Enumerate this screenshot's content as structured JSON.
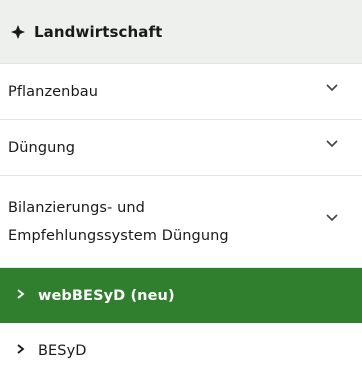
{
  "nav": {
    "header": {
      "label": "Landwirtschaft",
      "icon": "diamond-cross-icon"
    },
    "items": [
      {
        "label": "Pflanzenbau",
        "icon": "chevron-down-icon"
      },
      {
        "label": "Düngung",
        "icon": "chevron-down-icon"
      },
      {
        "label_line1": "Bilanzierungs- und",
        "label_line2": "Empfehlungssystem Düngung",
        "icon": "chevron-down-icon"
      }
    ],
    "subitems": [
      {
        "label": "webBESyD (neu)",
        "active": true,
        "icon": "chevron-right-icon"
      },
      {
        "label": "BESyD",
        "active": false,
        "icon": "chevron-right-icon"
      }
    ],
    "colors": {
      "active_bg": "#2f7f2e",
      "header_bg": "#eef0ee",
      "active_text": "#ffffff"
    }
  }
}
